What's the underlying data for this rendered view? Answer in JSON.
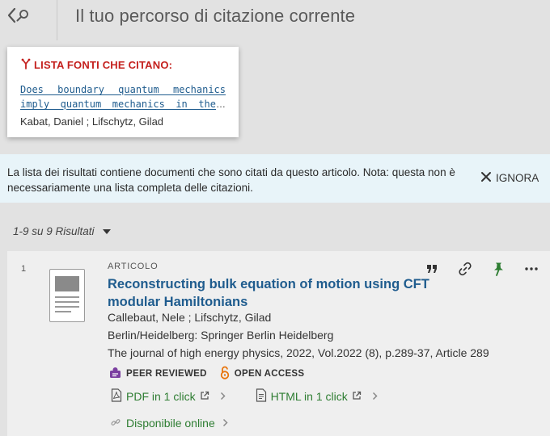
{
  "header": {
    "title": "Il tuo percorso di citazione corrente"
  },
  "citing_card": {
    "heading": "LISTA FONTI CHE CITANO:",
    "title_line1": "Does boundary quantum mechanics",
    "title_line2": "imply quantum mechanics in the",
    "ellipsis": "…",
    "authors": "Kabat, Daniel ; Lifschytz, Gilad"
  },
  "notice": {
    "text": "La lista dei risultati contiene documenti che sono citati da questo articolo. Nota: questa non è necessariamente una lista completa delle citazioni.",
    "dismiss_label": "IGNORA"
  },
  "results": {
    "count_label": "1-9 su 9 Risultati"
  },
  "result_items": [
    {
      "index": "1",
      "type": "ARTICOLO",
      "title": "Reconstructing bulk equation of motion using CFT modular Hamiltonians",
      "authors": "Callebaut, Nele ; Lifschytz, Gilad",
      "publisher": "Berlin/Heidelberg: Springer Berlin Heidelberg",
      "source": "The journal of high energy physics, 2022, Vol.2022 (8), p.289-37, Article 289",
      "badges": {
        "peer_reviewed": "PEER REVIEWED",
        "open_access": "OPEN ACCESS"
      },
      "links": {
        "pdf": "PDF in 1 click",
        "html": "HTML in 1 click",
        "online": "Disponibile online"
      }
    }
  ],
  "icons": {
    "back": "chevron-left-icon",
    "search": "search-icon",
    "citing": "fork-icon",
    "dismiss": "close-icon",
    "quote": "quote-icon",
    "permalink": "link-icon",
    "pin": "pin-icon",
    "more": "more-icon",
    "peer_reviewed": "peer-reviewed-icon",
    "open_access": "open-lock-icon",
    "pdf": "pdf-file-icon",
    "html": "html-file-icon",
    "external": "external-link-icon",
    "online": "link-icon"
  },
  "colors": {
    "brand_red": "#c4201d",
    "link_blue": "#1f5c8e",
    "link_green": "#2e7d32",
    "notice_bg": "#e8f4f9",
    "open_access_orange": "#e8750c",
    "peer_reviewed_purple": "#7b3fa0"
  }
}
